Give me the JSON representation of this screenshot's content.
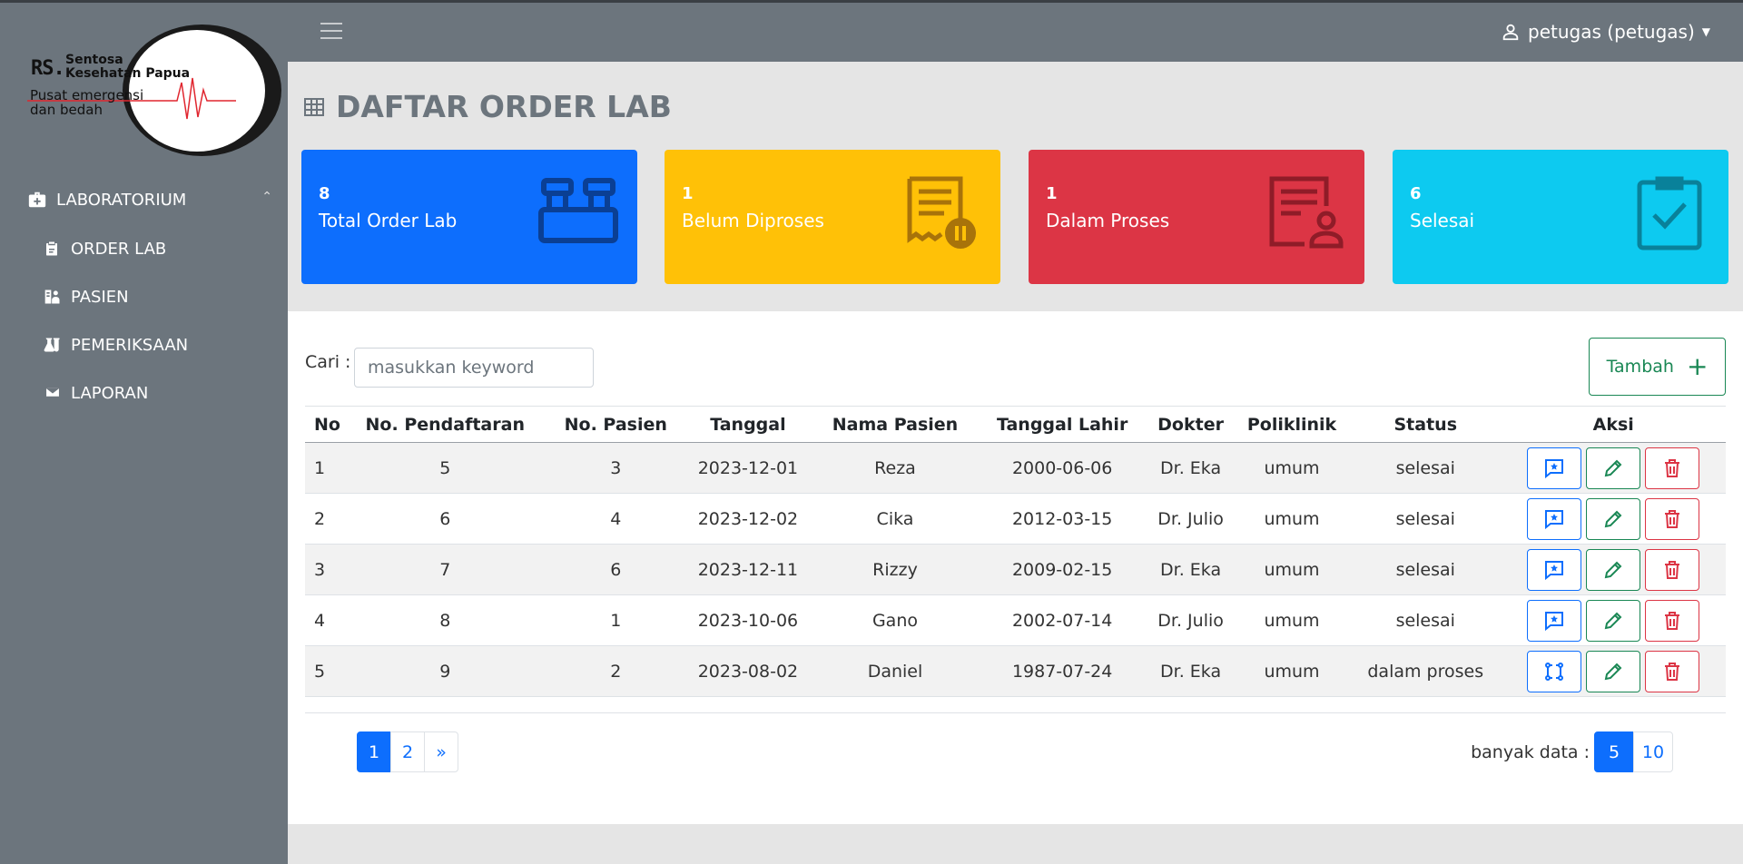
{
  "logo": {
    "rs": "RS.",
    "name": "Sentosa Kesehatan Papua",
    "tagline": "Pusat emergensi dan bedah"
  },
  "sidebar": {
    "section": {
      "label": "LABORATORIUM",
      "icon": "medkit-icon"
    },
    "items": [
      {
        "label": "ORDER LAB",
        "icon": "clipboard-icon"
      },
      {
        "label": "PASIEN",
        "icon": "patient-icon"
      },
      {
        "label": "PEMERIKSAAN",
        "icon": "flask-icon"
      },
      {
        "label": "LAPORAN",
        "icon": "envelope-icon"
      }
    ]
  },
  "topbar": {
    "user": "petugas (petugas)"
  },
  "page": {
    "title": "DAFTAR ORDER LAB"
  },
  "cards": [
    {
      "value": "8",
      "label": "Total Order Lab",
      "color": "#0d6efd",
      "icon": "test-tubes-icon"
    },
    {
      "value": "1",
      "label": "Belum Diproses",
      "color": "#ffc107",
      "icon": "receipt-pause-icon"
    },
    {
      "value": "1",
      "label": "Dalam Proses",
      "color": "#dc3545",
      "icon": "document-user-icon"
    },
    {
      "value": "6",
      "label": "Selesai",
      "color": "#0dcaf0",
      "icon": "clipboard-check-icon"
    }
  ],
  "search": {
    "label": "Cari :",
    "placeholder": "masukkan keyword",
    "value": ""
  },
  "add_button": {
    "label": "Tambah"
  },
  "table": {
    "columns": [
      "No",
      "No. Pendaftaran",
      "No. Pasien",
      "Tanggal",
      "Nama Pasien",
      "Tanggal Lahir",
      "Dokter",
      "Poliklinik",
      "Status",
      "Aksi"
    ],
    "rows": [
      {
        "no": "1",
        "no_pendaftaran": "5",
        "no_pasien": "3",
        "tanggal": "2023-12-01",
        "nama": "Reza",
        "tgl_lahir": "2000-06-06",
        "dokter": "Dr. Eka",
        "poli": "umum",
        "status": "selesai"
      },
      {
        "no": "2",
        "no_pendaftaran": "6",
        "no_pasien": "4",
        "tanggal": "2023-12-02",
        "nama": "Cika",
        "tgl_lahir": "2012-03-15",
        "dokter": "Dr. Julio",
        "poli": "umum",
        "status": "selesai"
      },
      {
        "no": "3",
        "no_pendaftaran": "7",
        "no_pasien": "6",
        "tanggal": "2023-12-11",
        "nama": "Rizzy",
        "tgl_lahir": "2009-02-15",
        "dokter": "Dr. Eka",
        "poli": "umum",
        "status": "selesai"
      },
      {
        "no": "4",
        "no_pendaftaran": "8",
        "no_pasien": "1",
        "tanggal": "2023-10-06",
        "nama": "Gano",
        "tgl_lahir": "2002-07-14",
        "dokter": "Dr. Julio",
        "poli": "umum",
        "status": "selesai"
      },
      {
        "no": "5",
        "no_pendaftaran": "9",
        "no_pasien": "2",
        "tanggal": "2023-08-02",
        "nama": "Daniel",
        "tgl_lahir": "1987-07-24",
        "dokter": "Dr. Eka",
        "poli": "umum",
        "status": "dalam proses"
      }
    ]
  },
  "pagination": {
    "pages": [
      "1",
      "2",
      "»"
    ],
    "active_page": "1"
  },
  "per_page": {
    "label": "banyak data :",
    "options": [
      "5",
      "10"
    ],
    "active": "5"
  },
  "colors": {
    "sidebar": "#6c757d",
    "primary": "#0d6efd",
    "success": "#198754",
    "danger": "#dc3545"
  }
}
